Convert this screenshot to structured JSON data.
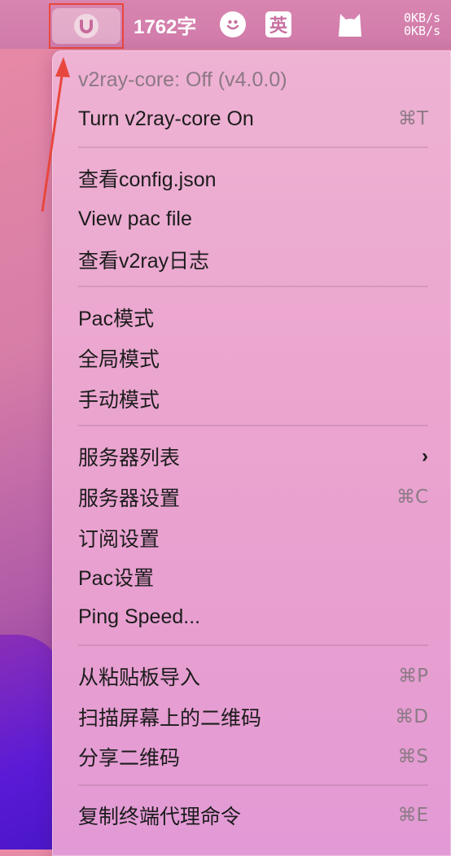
{
  "menubar": {
    "word_count": "1762字",
    "ime_label": "英",
    "net_up": "0KB/s",
    "net_down": "0KB/s"
  },
  "menu": {
    "status": "v2ray-core: Off  (v4.0.0)",
    "items": [
      {
        "label": "Turn v2ray-core On",
        "shortcut": "⌘T"
      },
      {
        "label": "查看config.json",
        "shortcut": ""
      },
      {
        "label": "View pac file",
        "shortcut": ""
      },
      {
        "label": "查看v2ray日志",
        "shortcut": ""
      },
      {
        "label": "Pac模式",
        "shortcut": ""
      },
      {
        "label": "全局模式",
        "shortcut": ""
      },
      {
        "label": "手动模式",
        "shortcut": ""
      },
      {
        "label": "服务器列表",
        "shortcut": "›"
      },
      {
        "label": "服务器设置",
        "shortcut": "⌘C"
      },
      {
        "label": "订阅设置",
        "shortcut": ""
      },
      {
        "label": "Pac设置",
        "shortcut": ""
      },
      {
        "label": "Ping Speed...",
        "shortcut": ""
      },
      {
        "label": "从粘贴板导入",
        "shortcut": "⌘P"
      },
      {
        "label": "扫描屏幕上的二维码",
        "shortcut": "⌘D"
      },
      {
        "label": "分享二维码",
        "shortcut": "⌘S"
      },
      {
        "label": "复制终端代理命令",
        "shortcut": "⌘E"
      }
    ]
  },
  "colors": {
    "annotation": "#e8473d",
    "menubar": "#d985b0"
  }
}
